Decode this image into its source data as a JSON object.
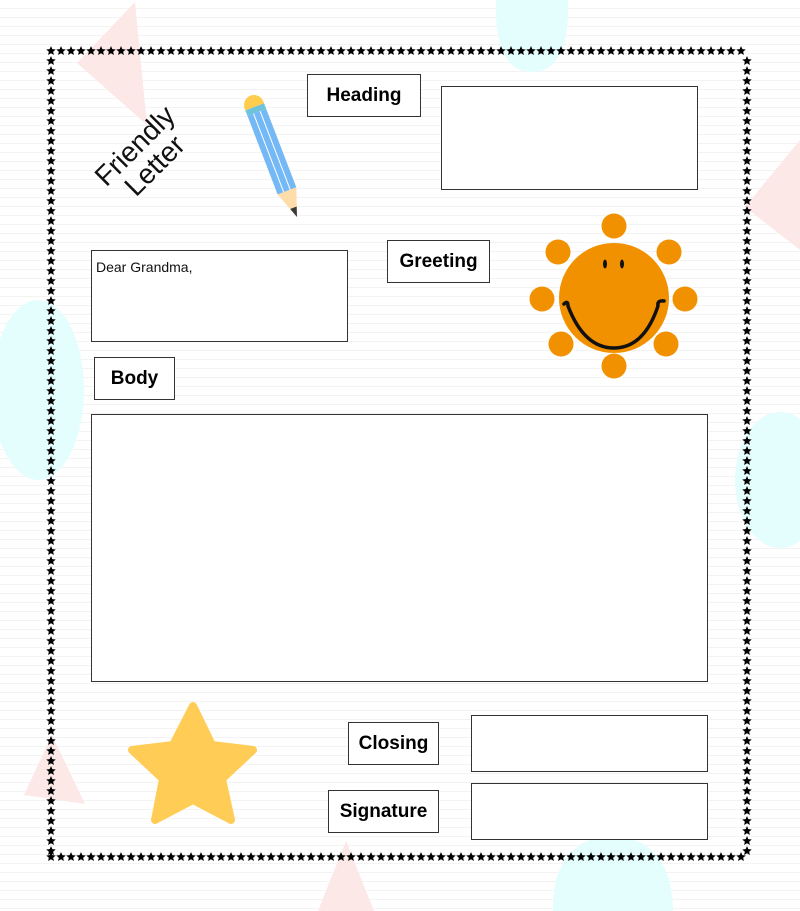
{
  "title": {
    "line1": "Friendly",
    "line2": "Letter"
  },
  "labels": {
    "heading": "Heading",
    "greeting": "Greeting",
    "body": "Body",
    "closing": "Closing",
    "signature": "Signature"
  },
  "fields": {
    "heading_value": "",
    "greeting_value": "Dear Grandma,",
    "body_value": "",
    "closing_value": "",
    "signature_value": ""
  },
  "icons": {
    "pencil": "pencil-icon",
    "sun": "smiling-sun-icon",
    "star": "star-icon",
    "border": "star-border"
  },
  "colors": {
    "sun": "#F29100",
    "star": "#FFCC55",
    "pencil_body": "#74B8F5",
    "pencil_band": "#6EC3DB",
    "pencil_eraser": "#FFCC4D",
    "pencil_wood": "#FFDDAA",
    "deco_pink": "#FDE8E8",
    "deco_cyan": "#E4FDFD"
  }
}
